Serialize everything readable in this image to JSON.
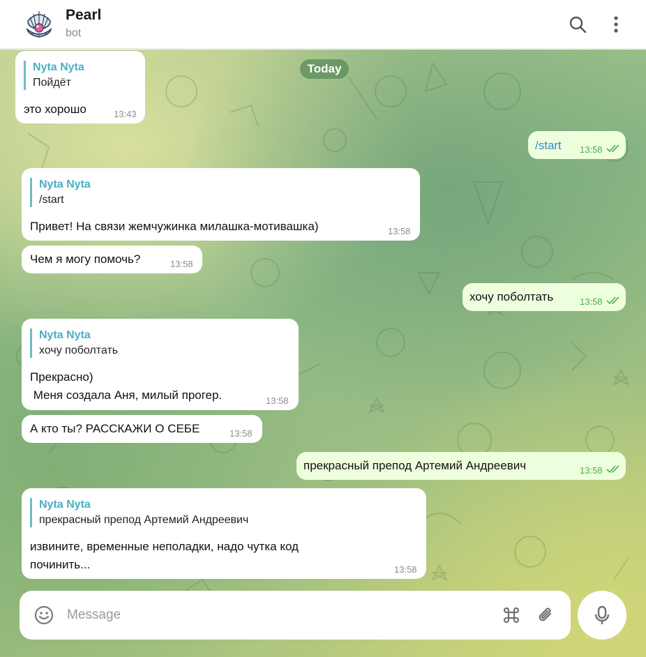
{
  "header": {
    "title": "Pearl",
    "subtitle": "bot"
  },
  "chat": {
    "date_label": "Today",
    "messages": [
      {
        "side": "in",
        "reply_name": "Nyta Nyta",
        "reply_text": "Пойдёт",
        "text": "это хорошо",
        "time": "13:43"
      },
      {
        "side": "out",
        "text": "/start",
        "time": "13:58"
      },
      {
        "side": "in",
        "reply_name": "Nyta Nyta",
        "reply_text": "/start",
        "text": "Привет! На связи жемчужинка милашка-мотивашка)",
        "time": "13:58"
      },
      {
        "side": "in",
        "text": "Чем я могу помочь?",
        "time": "13:58"
      },
      {
        "side": "out",
        "text": "хочу поболтать",
        "time": "13:58"
      },
      {
        "side": "in",
        "reply_name": "Nyta Nyta",
        "reply_text": "хочу поболтать",
        "text_lines": [
          "Прекрасно)",
          " Меня создала Аня, милый прогер."
        ],
        "time": "13:58"
      },
      {
        "side": "in",
        "text": "А кто ты? РАССКАЖИ О СЕБЕ",
        "time": "13:58"
      },
      {
        "side": "out",
        "text": "прекрасный препод Артемий Андреевич",
        "time": "13:58"
      },
      {
        "side": "in",
        "reply_name": "Nyta Nyta",
        "reply_text": "прекрасный препод Артемий Андреевич",
        "text_lines": [
          "извините, временные неполадки, надо чутка код",
          "починить..."
        ],
        "time": "13:58"
      }
    ]
  },
  "composer": {
    "placeholder": "Message"
  },
  "icons": {
    "search": "search-icon",
    "more": "more-vert-icon",
    "emoji": "emoji-icon",
    "command": "command-icon",
    "attach": "paperclip-icon",
    "mic": "microphone-icon"
  },
  "colors": {
    "accent_reply": "#4aaec4",
    "outgoing_bubble": "#eeffde",
    "outgoing_time": "#4fae4e",
    "link": "#2f89d8"
  }
}
